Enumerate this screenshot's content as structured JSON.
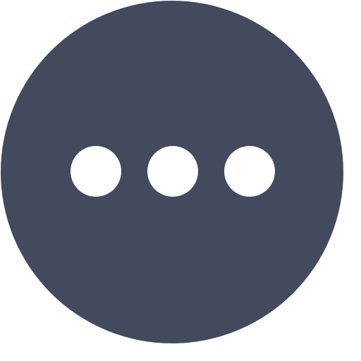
{
  "icon": {
    "name": "more-horizontal-icon",
    "dot_count": 3,
    "colors": {
      "background": "#ffffff",
      "circle": "#434a5e",
      "dots": "#ffffff"
    }
  }
}
